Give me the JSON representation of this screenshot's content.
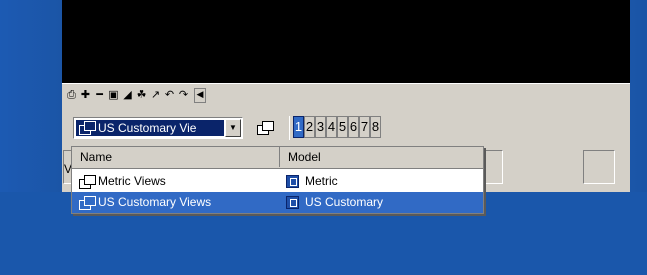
{
  "toolbar": {
    "tools": [
      {
        "name": "print-icon",
        "glyph": "⎙"
      },
      {
        "name": "add-icon",
        "glyph": "✚"
      },
      {
        "name": "remove-icon",
        "glyph": "━"
      },
      {
        "name": "window-icon",
        "glyph": "▣"
      },
      {
        "name": "graph-icon",
        "glyph": "◢"
      },
      {
        "name": "network-icon",
        "glyph": "☘"
      },
      {
        "name": "pen-icon",
        "glyph": "↗"
      },
      {
        "name": "undo-icon",
        "glyph": "↶"
      },
      {
        "name": "redo-icon",
        "glyph": "↷"
      },
      {
        "name": "scroll-left-icon",
        "glyph": "◀"
      }
    ]
  },
  "views_combo": {
    "selected_value": "US Customary Vie",
    "dropdown_arrow": "▼"
  },
  "view_numbers": [
    "1",
    "2",
    "3",
    "4",
    "5",
    "6",
    "7",
    "8"
  ],
  "active_view_number": "1",
  "dropdown": {
    "columns": {
      "name": "Name",
      "model": "Model"
    },
    "rows": [
      {
        "name": "Metric Views",
        "model": "Metric",
        "selected": false
      },
      {
        "name": "US Customary Views",
        "model": "US Customary",
        "selected": true
      }
    ]
  },
  "status": {
    "left_letter": "V"
  },
  "colors": {
    "desktop_blue": "#1a57ab",
    "panel_gray": "#d4d0c8",
    "selection_blue": "#316ac5"
  }
}
